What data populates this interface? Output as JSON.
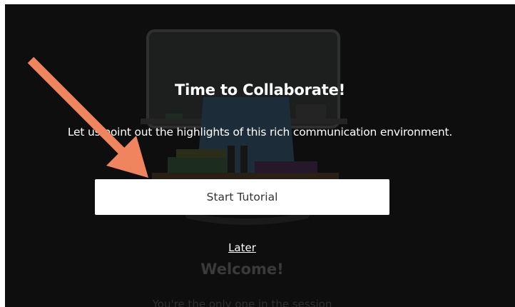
{
  "modal": {
    "title": "Time to Collaborate!",
    "subtitle": "Let us point out the highlights of this rich communication environment.",
    "start_button_label": "Start Tutorial",
    "later_label": "Later"
  },
  "background": {
    "welcome_text": "Welcome!",
    "partial_text": "You're the only one in the session"
  },
  "colors": {
    "overlay": "#0e0e0e",
    "arrow": "#f0845f",
    "button_bg": "#ffffff"
  }
}
